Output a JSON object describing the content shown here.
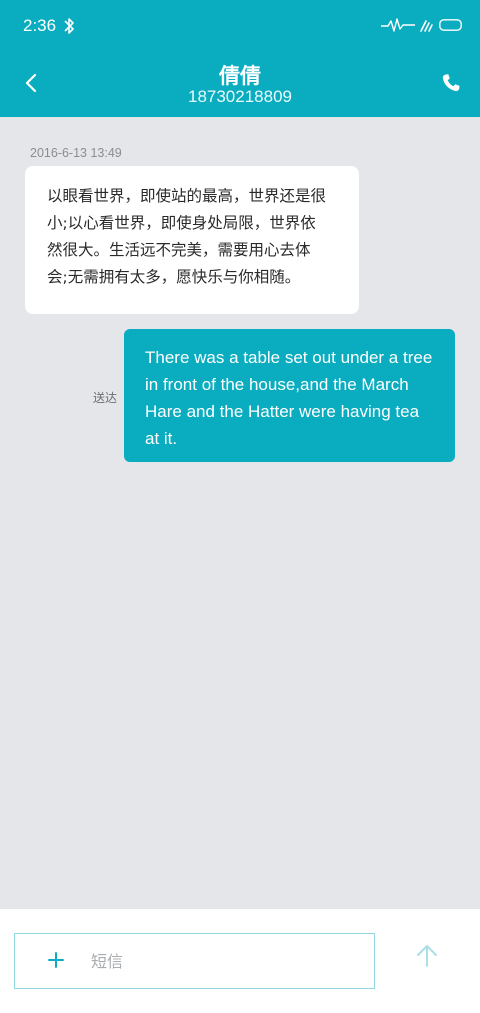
{
  "status_bar": {
    "time": "2:36",
    "icons": [
      "bluetooth-icon",
      "signal-icon",
      "wifi-icon",
      "battery-icon"
    ]
  },
  "header": {
    "contact_name": "倩倩",
    "contact_number": "18730218809",
    "back_icon": "back-arrow-icon",
    "call_icon": "phone-icon"
  },
  "messages": {
    "timestamp": "2016-6-13 13:49",
    "incoming": {
      "lines": [
        "以眼看世界，即使站的最高，世界还是很",
        "小;以心看世界，即使身处局限，世界依",
        "然很大。生活远不完美，需要用心去体",
        "会;无需拥有太多，愿快乐与你相随。"
      ]
    },
    "outgoing": {
      "status": "送达",
      "lines": [
        "There was a table set out under a tree",
        "in front of the house,and the March",
        "Hare and the Hatter were having tea",
        "at it."
      ]
    }
  },
  "composer": {
    "placeholder": "短信",
    "value": "",
    "plus_icon": "plus-icon",
    "send_icon": "send-arrow-icon"
  },
  "colors": {
    "accent": "#0aacbf",
    "background": "#e5e6ea",
    "bubble_in": "#ffffff"
  }
}
